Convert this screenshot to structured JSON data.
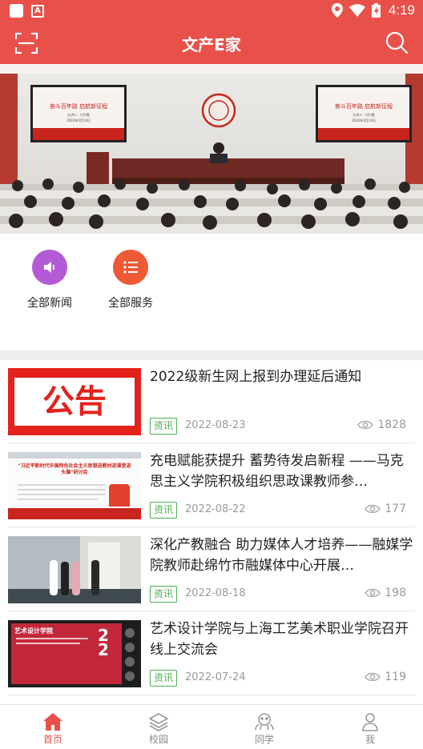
{
  "status_bar": {
    "time": "4:19"
  },
  "header": {
    "title": "文产E家"
  },
  "banner": {
    "screen_title": "奋斗百年路 启航新征程",
    "screen_subtitle": "主讲人：付兴胜",
    "screen_date": "2022年3月14日"
  },
  "quick_entries": [
    {
      "label": "全部新闻",
      "icon": "speaker-icon",
      "color": "#b35bd6"
    },
    {
      "label": "全部服务",
      "icon": "list-icon",
      "color": "#ee5a36"
    }
  ],
  "news": [
    {
      "title": "2022级新生网上报到办理延后通知",
      "tag": "资讯",
      "date": "2022-08-23",
      "views": "1828",
      "thumb_text": "公告"
    },
    {
      "title": "充电赋能获提升 蓄势待发启新程 ——马克思主义学院积极组织思政课教师参…",
      "tag": "资讯",
      "date": "2022-08-22",
      "views": "177",
      "thumb_text": "\"习近平新时代中国特色社会主义思想进教材进课堂进头脑\"研讨会"
    },
    {
      "title": "深化产教融合 助力媒体人才培养——融媒学院教师赴绵竹市融媒体中心开展…",
      "tag": "资讯",
      "date": "2022-08-18",
      "views": "198"
    },
    {
      "title": "艺术设计学院与上海工艺美术职业学院召开线上交流会",
      "tag": "资讯",
      "date": "2022-07-24",
      "views": "119",
      "thumb_text": "艺术设计学院"
    }
  ],
  "bottom_nav": [
    {
      "label": "首页",
      "icon": "home-icon",
      "active": true
    },
    {
      "label": "校园",
      "icon": "layers-icon",
      "active": false
    },
    {
      "label": "同学",
      "icon": "classmates-icon",
      "active": false
    },
    {
      "label": "我",
      "icon": "person-icon",
      "active": false
    }
  ],
  "colors": {
    "brand": "#e8514a",
    "tag": "#4caf50"
  }
}
